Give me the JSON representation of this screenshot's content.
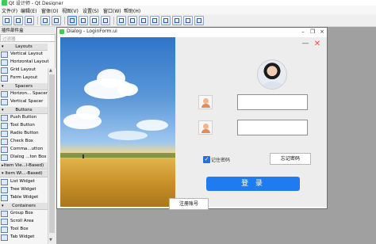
{
  "app": {
    "title": "Qt 设计师 - Qt Designer"
  },
  "menu": [
    "文件(F)",
    "编辑(E)",
    "窗体(O)",
    "视图(V)",
    "设置(S)",
    "窗口(W)",
    "帮助(H)"
  ],
  "toolbar_icons": [
    "new-file-icon",
    "open-file-icon",
    "save-icon",
    "copy-icon",
    "paste-icon",
    "widget-edit-icon",
    "signal-slot-icon",
    "buddy-icon",
    "tab-order-icon",
    "layout-horizontal-icon",
    "layout-vertical-icon",
    "layout-split-h-icon",
    "layout-split-v-icon",
    "layout-grid-icon",
    "layout-form-icon",
    "break-layout-icon",
    "adjust-size-icon"
  ],
  "widget_box": {
    "title": "插件部件盒",
    "filter_placeholder": "过滤器",
    "sections": [
      {
        "label": "Layouts",
        "items": [
          "Vertical Layout",
          "Horizontal Layout",
          "Grid Layout",
          "Form Layout"
        ]
      },
      {
        "label": "Spacers",
        "items": [
          "Horizon... Spacer",
          "Vertical Spacer"
        ]
      },
      {
        "label": "Buttons",
        "items": [
          "Push Button",
          "Tool Button",
          "Radio Button",
          "Check Box",
          "Comma...utton",
          "Dialog ...ton Box"
        ]
      },
      {
        "label": "Item Vie...l-Based)",
        "items": []
      },
      {
        "label": "Item Wi...-Based)",
        "items": [
          "List Widget",
          "Tree Widget",
          "Table Widget"
        ]
      },
      {
        "label": "Containers",
        "items": [
          "Group Box",
          "Scroll Area",
          "Tool Box",
          "Tab Widget"
        ]
      }
    ]
  },
  "form_window": {
    "title": "Dialog - LoginForm.ui",
    "remember_label": "记住密码",
    "forgot_button": "忘记密码",
    "login_button": "登 录",
    "register_button": "注册账号",
    "close_glyph": "✕",
    "minimize_glyph": "—",
    "check_glyph": "✓"
  },
  "colors": {
    "accent": "#1e7cf0",
    "close": "#ff4a3a",
    "qt_green": "#41cd52"
  }
}
